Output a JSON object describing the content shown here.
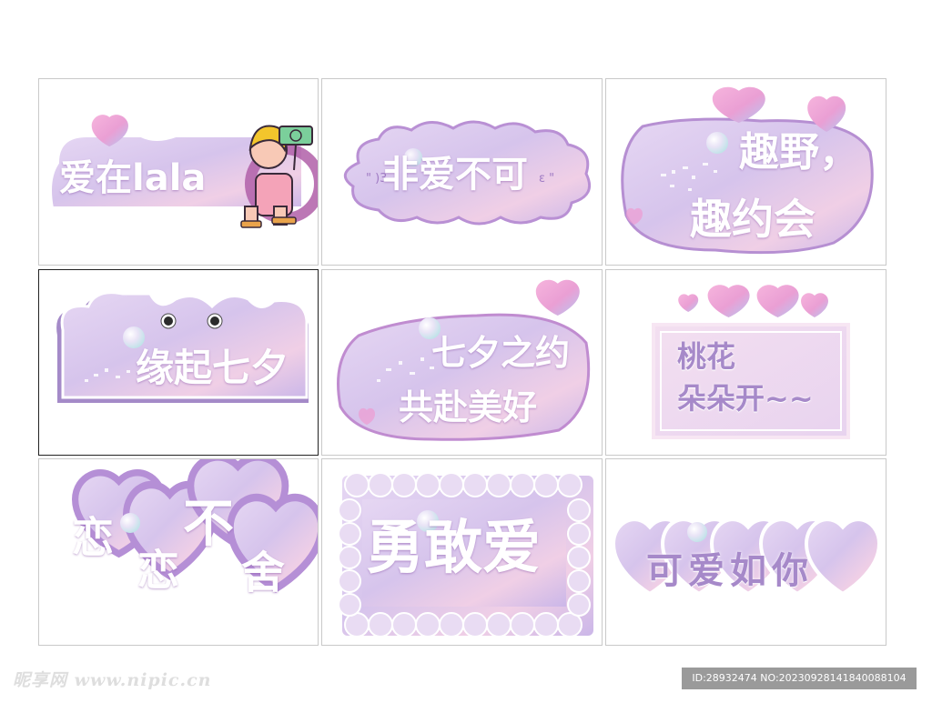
{
  "colors": {
    "pastel_purple": "#d8c4ec",
    "pastel_pink": "#f1c4e0",
    "outline": "#b48ccd",
    "heart": "#ee9bd2"
  },
  "signs": [
    {
      "text": "爱在lala"
    },
    {
      "text": "非爱不可"
    },
    {
      "line1": "趣野，",
      "line2": "趣约会"
    },
    {
      "text": "缘起七夕"
    },
    {
      "line1": "七夕之约",
      "line2": "共赴美好"
    },
    {
      "line1": "桃花",
      "line2": "朵朵开~~"
    },
    {
      "w1": "恋",
      "w2": "恋",
      "w3": "不",
      "w4": "舍"
    },
    {
      "text": "勇敢爱"
    },
    {
      "text": "可爱如你"
    }
  ],
  "watermark": {
    "logo": "昵享网 www.nipic.cn"
  },
  "image_id": "ID:28932474 NO:20230928141840088104"
}
